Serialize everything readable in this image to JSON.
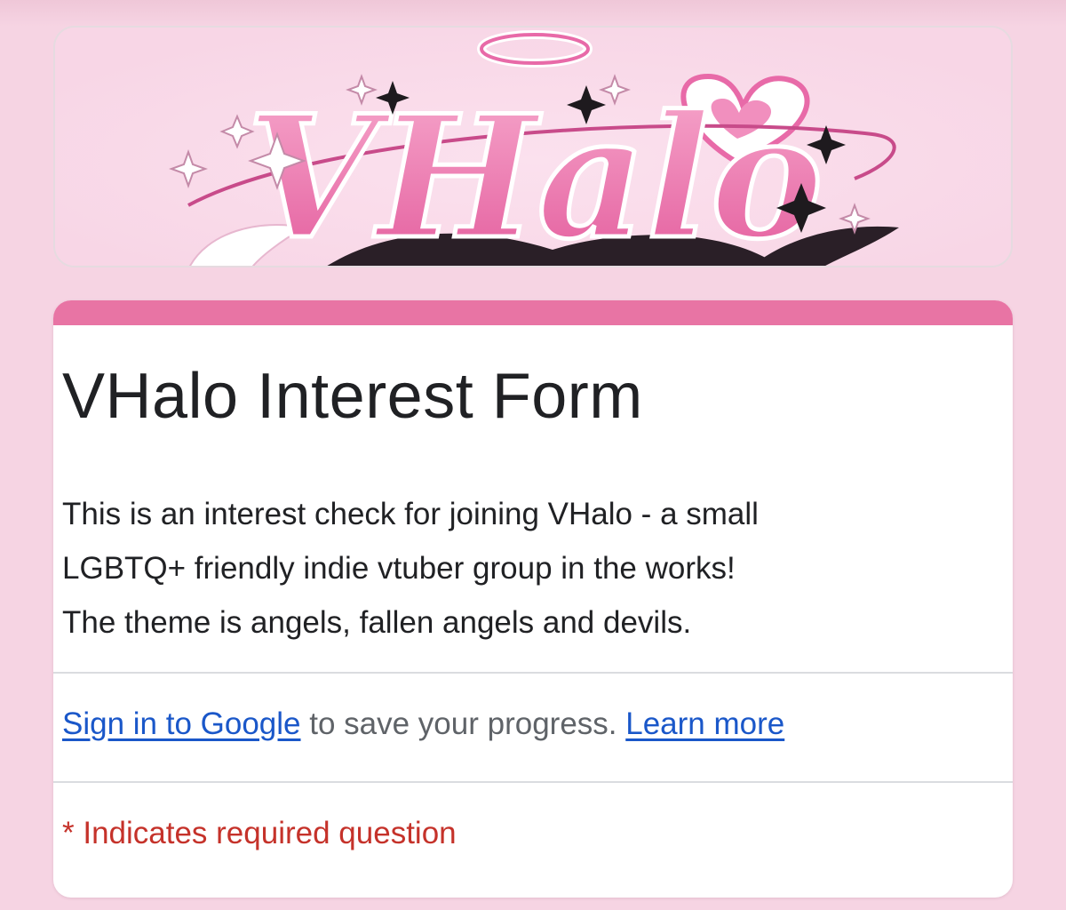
{
  "banner": {
    "logo_text": "VHalo"
  },
  "form": {
    "title": "VHalo Interest Form",
    "description": "This is an interest check for joining VHalo - a small\nLGBTQ+ friendly indie vtuber group in the works!\nThe theme is angels, fallen angels and devils.",
    "signin_link": "Sign in to Google",
    "signin_text": " to save your progress. ",
    "learn_more": "Learn more",
    "required_note": "* Indicates required question"
  },
  "colors": {
    "background": "#f6d4e3",
    "accent": "#e874a4",
    "link": "#1a57c9",
    "required": "#c5322a"
  }
}
